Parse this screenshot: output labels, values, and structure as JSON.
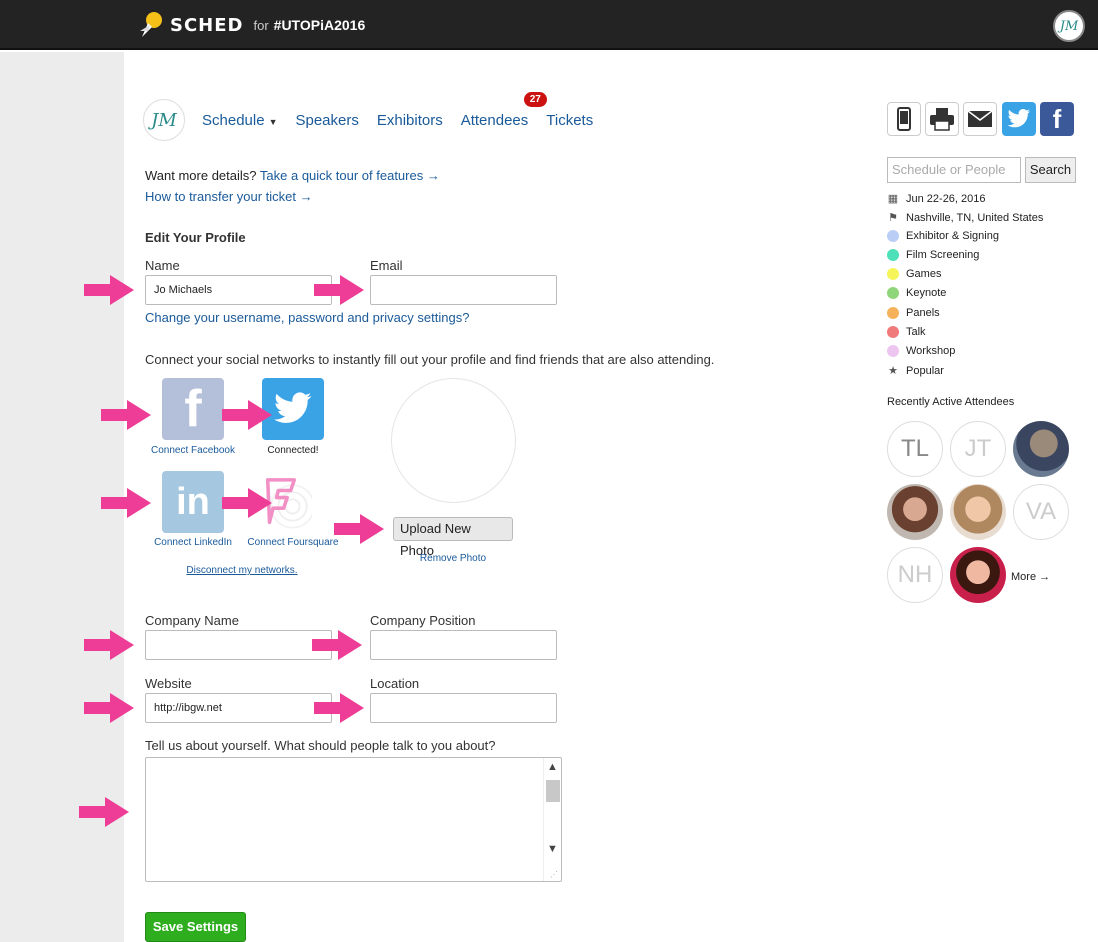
{
  "topbar": {
    "brand": "SCHED",
    "for": "for",
    "event": "#UTOPiA2016",
    "avatar_initials": "JM"
  },
  "subnav": {
    "logo_initials": "JM",
    "links": [
      "Schedule",
      "Speakers",
      "Exhibitors",
      "Attendees",
      "Tickets"
    ],
    "attendees_badge": "27"
  },
  "intro": {
    "prefix": "Want more details?",
    "tour_link": "Take a quick tour of features →",
    "transfer_link": "How to transfer your ticket →"
  },
  "profile": {
    "heading": "Edit Your Profile",
    "name_label": "Name",
    "name_value": "Jo Michaels",
    "email_label": "Email",
    "email_value": "",
    "settings_link": "Change your username, password and privacy settings?",
    "social_text": "Connect your social networks to instantly fill out your profile and find friends that are also attending.",
    "social": {
      "facebook": "Connect Facebook",
      "twitter": "Connected!",
      "linkedin": "Connect LinkedIn",
      "foursquare": "Connect Foursquare",
      "disconnect": "Disconnect my networks."
    },
    "upload_button": "Upload New Photo",
    "remove_photo": "Remove Photo",
    "company_label": "Company Name",
    "company_value": "",
    "position_label": "Company Position",
    "position_value": "",
    "website_label": "Website",
    "website_value": "http://ibgw.net",
    "location_label": "Location",
    "location_value": "",
    "about_label": "Tell us about yourself. What should people talk to you about?",
    "about_value": "",
    "save_button": "Save Settings"
  },
  "sidebar": {
    "search_placeholder": "Schedule or People",
    "search_button": "Search",
    "dates": "Jun 22-26, 2016",
    "location": "Nashville, TN, United States",
    "categories": [
      {
        "label": "Exhibitor & Signing",
        "color": "#b9cdf5"
      },
      {
        "label": "Film Screening",
        "color": "#4ee0b8"
      },
      {
        "label": "Games",
        "color": "#f5f55a"
      },
      {
        "label": "Keynote",
        "color": "#8fd67a"
      },
      {
        "label": "Panels",
        "color": "#f5b25a"
      },
      {
        "label": "Talk",
        "color": "#f07a7a"
      },
      {
        "label": "Workshop",
        "color": "#ecc6f0"
      }
    ],
    "popular": "Popular",
    "recent_heading": "Recently Active Attendees",
    "attendees": [
      "TL",
      "JT",
      "VA",
      "NH"
    ],
    "more": "More →"
  },
  "colors": {
    "topbar": "#232323",
    "link": "#1a5a9a",
    "arrow": "#ee3d96",
    "save": "#2eae1e",
    "badge": "#cc1111",
    "twitter": "#3aa3e6",
    "facebook": "#3b5998"
  }
}
